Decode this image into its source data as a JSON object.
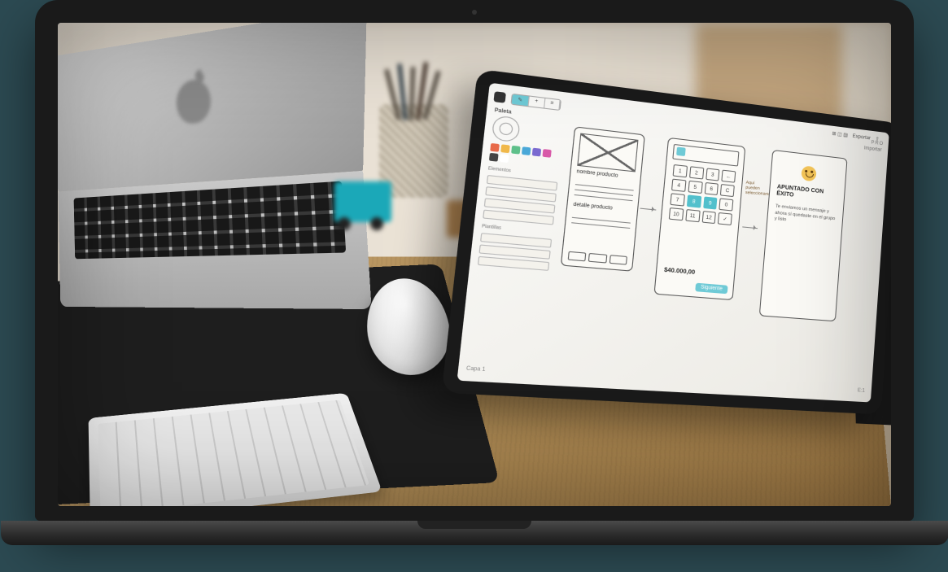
{
  "tablet_app": {
    "topbar": {
      "tool_segment": {
        "opt1": "✎",
        "opt2": "+",
        "opt3": "≡"
      },
      "center_label": "PRO",
      "right": {
        "exportar": "Exportar",
        "importar": "Importar"
      }
    },
    "palette": {
      "header": "Paleta",
      "sections_label": "Elementos",
      "items_label": "Plantillas"
    },
    "swatch_colors": [
      "#e86a4a",
      "#f0b84a",
      "#5ec08a",
      "#4aa8d8",
      "#7a6ad0",
      "#d85aa8",
      "#444444",
      "#ffffff"
    ],
    "phone1": {
      "line1": "nombre  producto",
      "line2": "detalle  producto"
    },
    "phone2": {
      "keys": [
        "1",
        "2",
        "3",
        "←",
        "4",
        "5",
        "6",
        "C",
        "7",
        "8",
        "9",
        "0",
        "10",
        "11",
        "12",
        "✓"
      ],
      "total": "$40.000,00",
      "action": "Siguiente",
      "side_note": "Aquí pueden seleccionarse"
    },
    "phone3": {
      "title": "APUNTADO CON ÉXITO",
      "body": "Te enviamos un mensaje y ahora sí quedaste en el grupo y listo"
    },
    "footer": {
      "layer": "Capa 1",
      "zoom": "E:1"
    }
  }
}
